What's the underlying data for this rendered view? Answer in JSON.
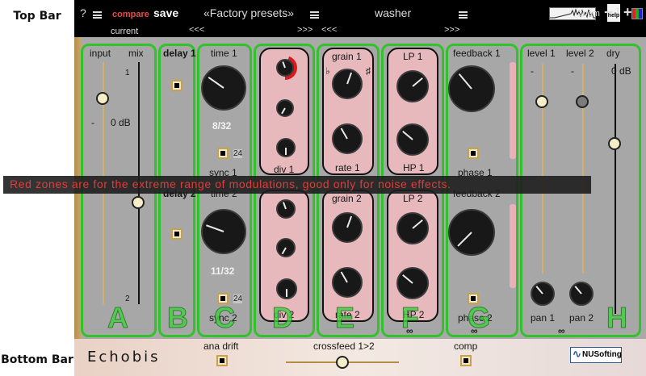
{
  "annotations": {
    "top_bar": "Top Bar",
    "bottom_bar": "Bottom Bar",
    "note": "Red zones are for the extreme range of modulations, good only for noise effects."
  },
  "topbar": {
    "help_q": "?",
    "compare": "compare",
    "save": "save",
    "preset": "«Factory presets»",
    "preset_name": "washer",
    "current": "current",
    "left_arrows": "<<<",
    "right_arrows": ">>>",
    "left_arrows2": "<<<",
    "right_arrows2": ">>>",
    "help": "help",
    "zoom": "zoom",
    "minus": "−",
    "one": "1",
    "plus": "+"
  },
  "sections": {
    "A": {
      "letter": "A",
      "input": "input",
      "mix": "mix",
      "db": "0 dB",
      "minus": "-",
      "one": "1",
      "two": "2",
      "input_level": 0.85,
      "mix_level": 0.42
    },
    "B": {
      "letter": "B",
      "delay1": "delay 1",
      "delay2": "delay 2"
    },
    "C": {
      "letter": "C",
      "time1": "time 1",
      "time1_val": "8/32",
      "sync1": "sync 1",
      "sync1_num": "24",
      "time2": "time 2",
      "time2_val": "11/32",
      "sync2": "sync 2",
      "sync2_num": "24"
    },
    "D": {
      "letter": "D",
      "div1": "div 1",
      "div2": "div 2"
    },
    "E": {
      "letter": "E",
      "grain1": "grain 1",
      "rate1": "rate 1",
      "grain2": "grain 2",
      "rate2": "rate 2",
      "flat": "♭",
      "sharp": "♯"
    },
    "F": {
      "letter": "F",
      "lp1": "LP 1",
      "hp1": "HP 1",
      "lp2": "LP 2",
      "hp2": "HP 2",
      "link": "∞"
    },
    "G": {
      "letter": "G",
      "fb1": "feedback 1",
      "phase1": "phase 1",
      "fb2": "feedback 2",
      "phase2": "phase 2",
      "link": "∞"
    },
    "H": {
      "letter": "H",
      "level1": "level 1",
      "level2": "level 2",
      "dry": "dry",
      "dash1": "-",
      "dash2": "-",
      "dry_db": "0 dB",
      "pan1": "pan 1",
      "pan2": "pan 2",
      "link": "∞",
      "level1_level": 0.82,
      "level2_level": 0.82,
      "dry_level": 0.68
    }
  },
  "bottom": {
    "name": "Echobis",
    "ana_drift": "ana drift",
    "crossfeed": "crossfeed 1>2",
    "comp": "comp",
    "brand": "NUSofting",
    "crossfeed_level": 0.5
  },
  "colors": {
    "accent_green": "#32c22a",
    "red_zone": "#d91b1b",
    "pink_panel": "#e7b9bd",
    "gold": "#c9a14a"
  }
}
